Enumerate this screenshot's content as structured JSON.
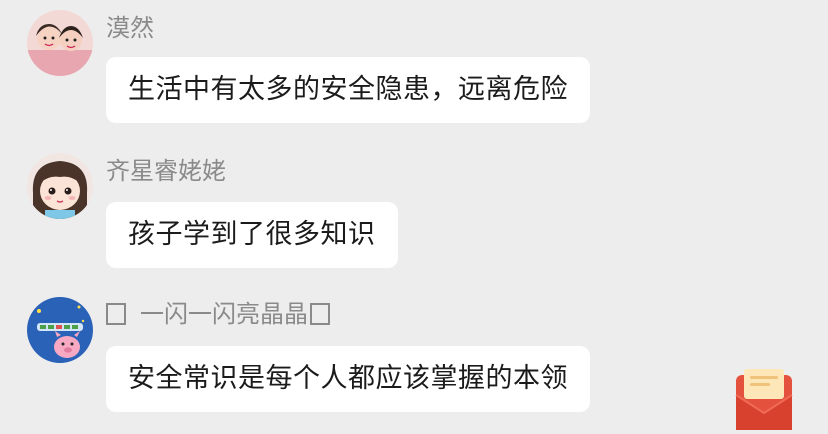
{
  "comments": [
    {
      "nickname": "漠然",
      "text": "生活中有太多的安全隐患，远离危险"
    },
    {
      "nickname": "齐星睿姥姥",
      "text": "孩子学到了很多知识"
    },
    {
      "nickname_prefix_glyph": "☐",
      "nickname": "一闪一闪亮晶晶",
      "nickname_suffix_glyph": "☐",
      "text": "安全常识是每个人都应该掌握的本领"
    }
  ],
  "icons": {
    "red_packet": "red-envelope-icon"
  },
  "colors": {
    "background": "#ededed",
    "bubble": "#ffffff",
    "nickname": "#8a8a8a",
    "text": "#1b1b1b",
    "red_packet": "#e4513d"
  }
}
